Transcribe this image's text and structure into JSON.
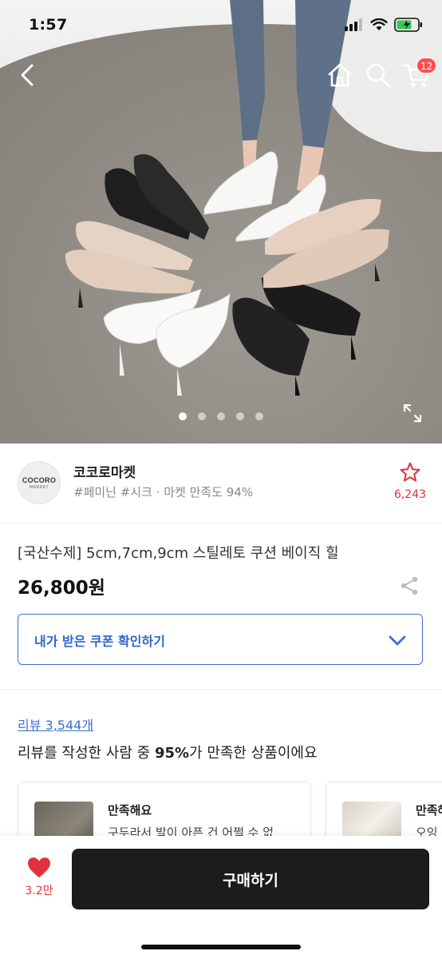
{
  "status_bar": {
    "time": "1:57"
  },
  "nav": {
    "cart_badge": "12"
  },
  "carousel": {
    "total": 5,
    "active": 0
  },
  "seller": {
    "logo_line1": "COCORO",
    "logo_line2": "MARKET",
    "name": "코코로마켓",
    "meta": "#페미닌 #시크 · 마켓 만족도 94%",
    "favorite_count": "6,243"
  },
  "product": {
    "title": "[국산수제] 5cm,7cm,9cm 스틸레토 쿠션 베이직 힐",
    "price": "26,800원"
  },
  "coupon": {
    "label": "내가 받은 쿠폰 확인하기"
  },
  "reviews": {
    "link": "리뷰 3,544개",
    "summary_prefix": "리뷰를 작성한 사람 중 ",
    "summary_percent": "95%",
    "summary_suffix": "가 만족한 상품이에요",
    "cards": [
      {
        "title": "만족해요",
        "text": "구두라서 발이 아픈 건 어쩔 수 없"
      },
      {
        "title": "만족해요",
        "text": "오잉"
      }
    ]
  },
  "bottom_bar": {
    "like_count": "3.2만",
    "buy_label": "구매하기"
  },
  "colors": {
    "accent_blue": "#3a6fcf",
    "like_red": "#e0323c",
    "buy_button": "#1c1c1c"
  }
}
